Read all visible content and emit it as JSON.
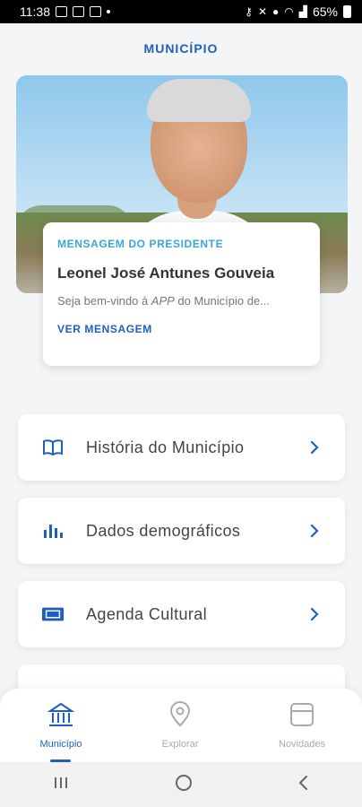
{
  "status_bar": {
    "time": "11:38",
    "battery": "65%"
  },
  "page": {
    "title": "MUNICÍPIO"
  },
  "president_message": {
    "kicker": "MENSAGEM DO PRESIDENTE",
    "name": "Leonel José Antunes Gouveia",
    "text_prefix": "Seja bem-vindo à ",
    "text_app": "APP",
    "text_suffix": " do Município de...",
    "link": "VER MENSAGEM"
  },
  "menu": [
    {
      "label": "História do Município",
      "icon": "book-icon"
    },
    {
      "label": "Dados demográficos",
      "icon": "bar-chart-icon"
    },
    {
      "label": "Agenda Cultural",
      "icon": "ticket-icon"
    }
  ],
  "bottom_nav": [
    {
      "label": "Município",
      "icon": "bank-icon",
      "active": true
    },
    {
      "label": "Explorar",
      "icon": "location-pin-icon",
      "active": false
    },
    {
      "label": "Novidades",
      "icon": "calendar-icon",
      "active": false
    }
  ],
  "colors": {
    "accent": "#1f5fbf",
    "kicker": "#3aa6d8",
    "background": "#f4f5f7",
    "inactive": "#aaaaaa"
  }
}
